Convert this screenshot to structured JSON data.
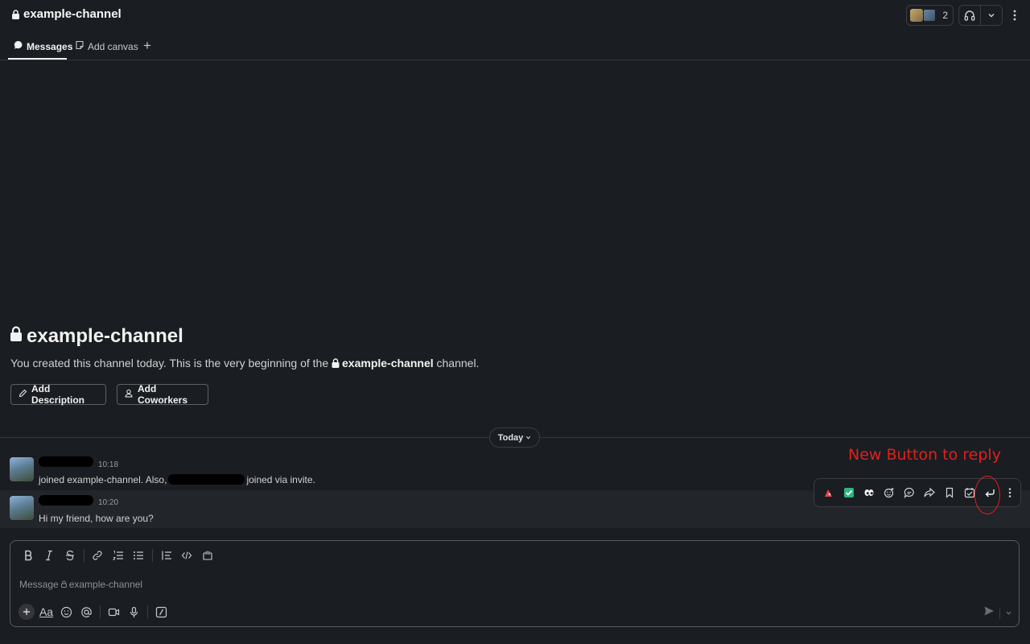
{
  "channel": {
    "name": "example-channel",
    "member_count": "2"
  },
  "tabs": [
    {
      "label": "Messages",
      "icon": "message-icon"
    },
    {
      "label": "Add canvas",
      "icon": "canvas-icon"
    },
    {
      "label": "+",
      "icon": "plus-icon"
    }
  ],
  "intro": {
    "title": "example-channel",
    "desc_prefix": "You created this channel today. This is the very beginning of the",
    "desc_channel": "example-channel",
    "desc_suffix": "channel.",
    "add_description": "Add Description",
    "add_coworkers": "Add Coworkers"
  },
  "divider": {
    "label": "Today"
  },
  "messages": [
    {
      "time": "10:18",
      "text_a": "joined example-channel. Also,",
      "text_b": "joined via invite."
    },
    {
      "time": "10:20",
      "text": "Hi my friend, how are you?"
    }
  ],
  "actions": [
    "reaction-icon",
    "checkmark-icon",
    "eyes-icon",
    "add-reaction-icon",
    "thread-icon",
    "share-icon",
    "bookmark-icon",
    "reminder-icon",
    "reply-icon",
    "more-icon"
  ],
  "annotation": "New Button to reply",
  "composer": {
    "placeholder_prefix": "Message",
    "placeholder_channel": "example-channel",
    "format_label": "Aa"
  },
  "colors": {
    "background": "#1a1d21",
    "annotation": "#e0201f",
    "border": "#5a5c60"
  }
}
